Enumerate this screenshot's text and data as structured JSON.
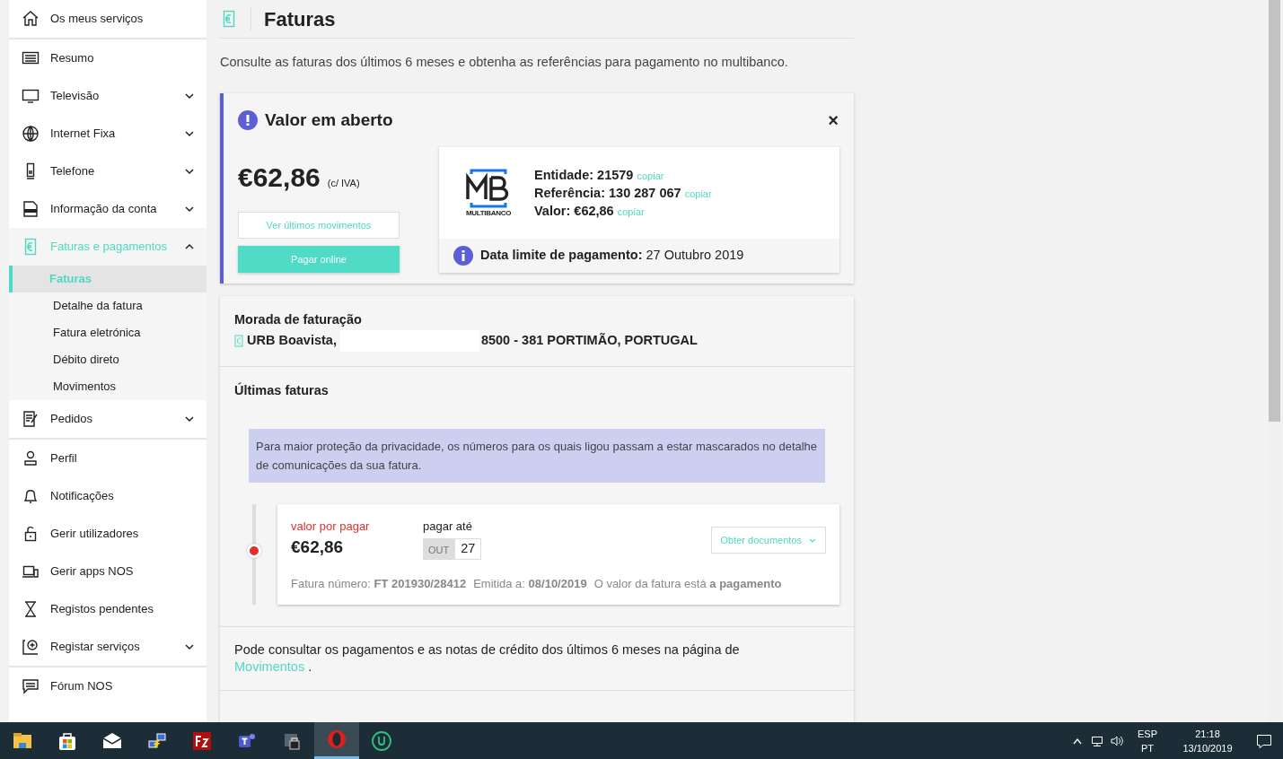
{
  "sidebar": {
    "groups": [
      [
        {
          "label": "Os meus serviços",
          "selected": false
        }
      ],
      [
        {
          "label": "Resumo",
          "selected": false
        },
        {
          "label": "Televisão",
          "selected": false,
          "expanded": false
        },
        {
          "label": "Internet Fixa",
          "selected": false,
          "expanded": false
        },
        {
          "label": "Telefone",
          "selected": false,
          "expanded": false
        },
        {
          "label": "Informação da conta",
          "selected": false,
          "expanded": false
        },
        {
          "label": "Faturas e pagamentos",
          "selected": true,
          "expanded": true,
          "children": [
            {
              "label": "Faturas",
              "selected": true
            },
            {
              "label": "Detalhe da fatura",
              "selected": false
            },
            {
              "label": "Fatura eletrónica",
              "selected": false
            },
            {
              "label": "Débito direto",
              "selected": false
            },
            {
              "label": "Movimentos",
              "selected": false
            }
          ]
        },
        {
          "label": "Pedidos",
          "selected": false,
          "expanded": false
        }
      ],
      [
        {
          "label": "Perfil",
          "selected": false
        },
        {
          "label": "Notificações",
          "selected": false
        },
        {
          "label": "Gerir utilizadores",
          "selected": false
        },
        {
          "label": "Gerir apps NOS",
          "selected": false
        },
        {
          "label": "Registos pendentes",
          "selected": false
        },
        {
          "label": "Registar serviços",
          "selected": false,
          "expanded": false
        }
      ],
      [
        {
          "label": "Fórum NOS",
          "selected": false
        }
      ]
    ]
  },
  "page": {
    "title": "Faturas",
    "subtitle": "Consulte as faturas dos últimos 6 meses e obtenha as referências para pagamento no multibanco."
  },
  "open_amount": {
    "title": "Valor em aberto",
    "close": "×",
    "amount": "€62,86",
    "tax_note": "(c/ IVA)",
    "buttons": [
      {
        "label": "Ver últimos movimentos",
        "kind": "outline"
      },
      {
        "label": "Pagar online",
        "kind": "primary"
      }
    ],
    "multibanco": {
      "logo_caption": "MULTIBANCO",
      "fields": [
        {
          "label": "Entidade:",
          "value": "21579",
          "action": "copiar"
        },
        {
          "label": "Referência:",
          "value": "130 287 067",
          "action": "copiar"
        },
        {
          "label": "Valor:",
          "value": "€62,86",
          "action": "copiar"
        }
      ],
      "deadline_label": "Data limite de pagamento:",
      "deadline": "27 Outubro 2019"
    }
  },
  "billing_address": {
    "heading": "Morada de faturação",
    "street": "URB Boavista,",
    "postal": "8500 - 381 PORTIMÃO, PORTUGAL"
  },
  "invoices": {
    "heading": "Últimas faturas",
    "notice": "Para maior proteção da privacidade, os números para os quais ligou passam a estar mascarados no detalhe de comunicações da sua fatura.",
    "items": [
      {
        "status": "valor por pagar",
        "amount": "€62,86",
        "due_label": "pagar até",
        "due_month": "OUT",
        "due_day": "27",
        "documents": "Obter documentos",
        "meta": [
          {
            "label": "Fatura número:",
            "value": "FT 201930/28412"
          },
          {
            "label": "Emitida a:",
            "value": "08/10/2019"
          },
          {
            "label": "O valor da fatura está",
            "value": "a pagamento"
          }
        ]
      }
    ],
    "footer": "Pode consultar os pagamentos e as notas de crédito dos últimos 6 meses na página de",
    "footer_link": "Movimentos",
    "footer_end": "."
  },
  "taskbar": {
    "apps": [
      {
        "selected": false
      },
      {
        "selected": false
      },
      {
        "selected": false
      },
      {
        "selected": false
      },
      {
        "selected": false
      },
      {
        "selected": false
      },
      {
        "selected": false
      },
      {
        "selected": true
      },
      {
        "selected": false
      }
    ],
    "language": "ESP",
    "layout": "PT",
    "time": "21:18",
    "date": "13/10/2019"
  }
}
